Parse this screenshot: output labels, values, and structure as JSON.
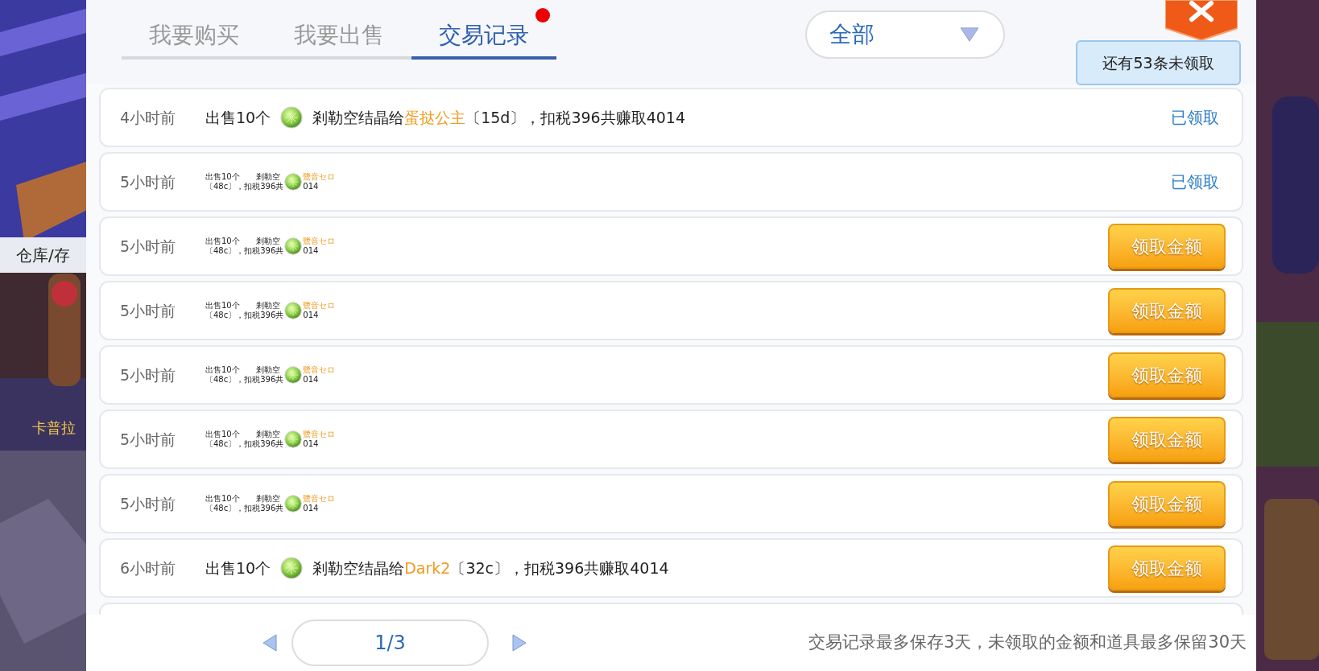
{
  "scene_labels": [
    {
      "kind": "sign",
      "text": "仓库/存"
    },
    {
      "kind": "npc",
      "text": "卡普拉"
    }
  ],
  "tabs": [
    {
      "label": "我要购买",
      "selected": false,
      "badge": false
    },
    {
      "label": "我要出售",
      "selected": false,
      "badge": false
    },
    {
      "label": "交易记录",
      "selected": true,
      "badge": true
    }
  ],
  "filter": {
    "value": "全部"
  },
  "tooltip": "还有53条未领取",
  "records": [
    {
      "time": "4小时前",
      "kind": "full",
      "sale": "出售10个",
      "item": "剎勒空结晶给",
      "buyer": "蛋挞公主",
      "tail": "〔15d〕，扣税396共赚取4014",
      "claimed": true,
      "action": "已领取"
    },
    {
      "time": "5小时前",
      "kind": "compact",
      "sale": "出售10个",
      "item": "剎勒空",
      "buyer": "鷺音セロ",
      "tail": "〔48c〕，扣税396共",
      "tail_end": "014",
      "claimed": true,
      "action": "已领取"
    },
    {
      "time": "5小时前",
      "kind": "compact",
      "sale": "出售10个",
      "item": "剎勒空",
      "buyer": "鷺音セロ",
      "tail": "〔48c〕，扣税396共",
      "tail_end": "014",
      "claimed": false,
      "action": "领取金额"
    },
    {
      "time": "5小时前",
      "kind": "compact",
      "sale": "出售10个",
      "item": "剎勒空",
      "buyer": "鷺音セロ",
      "tail": "〔48c〕，扣税396共",
      "tail_end": "014",
      "claimed": false,
      "action": "领取金额"
    },
    {
      "time": "5小时前",
      "kind": "compact",
      "sale": "出售10个",
      "item": "剎勒空",
      "buyer": "鷺音セロ",
      "tail": "〔48c〕，扣税396共",
      "tail_end": "014",
      "claimed": false,
      "action": "领取金额"
    },
    {
      "time": "5小时前",
      "kind": "compact",
      "sale": "出售10个",
      "item": "剎勒空",
      "buyer": "鷺音セロ",
      "tail": "〔48c〕，扣税396共",
      "tail_end": "014",
      "claimed": false,
      "action": "领取金额"
    },
    {
      "time": "5小时前",
      "kind": "compact",
      "sale": "出售10个",
      "item": "剎勒空",
      "buyer": "鷺音セロ",
      "tail": "〔48c〕，扣税396共",
      "tail_end": "014",
      "claimed": false,
      "action": "领取金额"
    },
    {
      "time": "6小时前",
      "kind": "full",
      "sale": "出售10个",
      "item": "剎勒空结晶给",
      "buyer": "Dark2",
      "tail": "〔32c〕，扣税396共赚取4014",
      "claimed": false,
      "action": "领取金额"
    }
  ],
  "pagination": {
    "page": "1/3"
  },
  "note": "交易记录最多保存3天，未领取的金额和道具最多保留30天"
}
